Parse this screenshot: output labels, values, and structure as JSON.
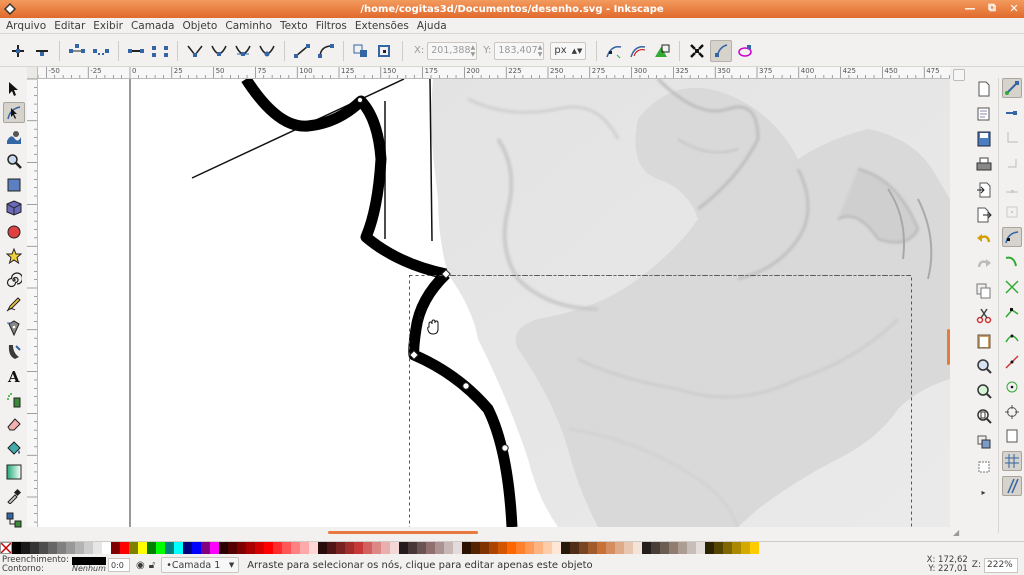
{
  "window": {
    "title": "/home/cogitas3d/Documentos/desenho.svg - Inkscape"
  },
  "menubar": {
    "items": [
      "Arquivo",
      "Editar",
      "Exibir",
      "Camada",
      "Objeto",
      "Caminho",
      "Texto",
      "Filtros",
      "Extensões",
      "Ajuda"
    ]
  },
  "controls": {
    "x_label": "X:",
    "x_value": "201,388",
    "y_label": "Y:",
    "y_value": "183,407",
    "unit": "px"
  },
  "ruler": {
    "labels": [
      "-50",
      "-25",
      "0",
      "25",
      "50",
      "75",
      "100",
      "125",
      "150",
      "175",
      "200",
      "225",
      "250",
      "275",
      "300",
      "325",
      "350",
      "375",
      "400",
      "425",
      "450",
      "475"
    ]
  },
  "status": {
    "fill_label": "Preenchimento:",
    "stroke_label": "Contorno:",
    "stroke_value": "Nenhum",
    "opacity": "0:0",
    "layer": "•Camada 1",
    "message": "Arraste para selecionar os nós, clique para editar apenas este objeto",
    "x_label": "X:",
    "x_value": "172,62",
    "y_label": "Y:",
    "y_value": "227,01",
    "zoom_label": "Z:",
    "zoom_value": "222%"
  },
  "colors": {
    "accent": "#e8793f",
    "palette": [
      "#000000",
      "#1a1a1a",
      "#333333",
      "#4d4d4d",
      "#666666",
      "#808080",
      "#999999",
      "#b3b3b3",
      "#cccccc",
      "#e6e6e6",
      "#ffffff",
      "#800000",
      "#ff0000",
      "#808000",
      "#ffff00",
      "#008000",
      "#00ff00",
      "#008080",
      "#00ffff",
      "#000080",
      "#0000ff",
      "#800080",
      "#ff00ff",
      "#2b0000",
      "#550000",
      "#800000",
      "#aa0000",
      "#d40000",
      "#ff0000",
      "#ff2a2a",
      "#ff5555",
      "#ff8080",
      "#ffaaaa",
      "#ffd5d5",
      "#280b0b",
      "#501616",
      "#782121",
      "#a02c2c",
      "#c83737",
      "#d35f5f",
      "#de8787",
      "#e9afaf",
      "#f4d7d7",
      "#241c1c",
      "#483737",
      "#6c5353",
      "#916f6f",
      "#ac9393",
      "#c8b7b7",
      "#e3dbdb",
      "#2b1100",
      "#552200",
      "#803300",
      "#aa4400",
      "#d45500",
      "#ff6600",
      "#ff7f2a",
      "#ff9955",
      "#ffb380",
      "#ffccaa",
      "#ffe6d5",
      "#28170b",
      "#502d16",
      "#784421",
      "#a05a2c",
      "#c87137",
      "#d38d5f",
      "#deaa87",
      "#e9c6af",
      "#f4e3d7",
      "#241f1c",
      "#483e37",
      "#6c5d53",
      "#917c6f",
      "#ac9d93",
      "#c8beb7",
      "#e3dedb",
      "#2b2200",
      "#554400",
      "#806600",
      "#aa8800",
      "#d4aa00",
      "#ffcc00"
    ]
  }
}
